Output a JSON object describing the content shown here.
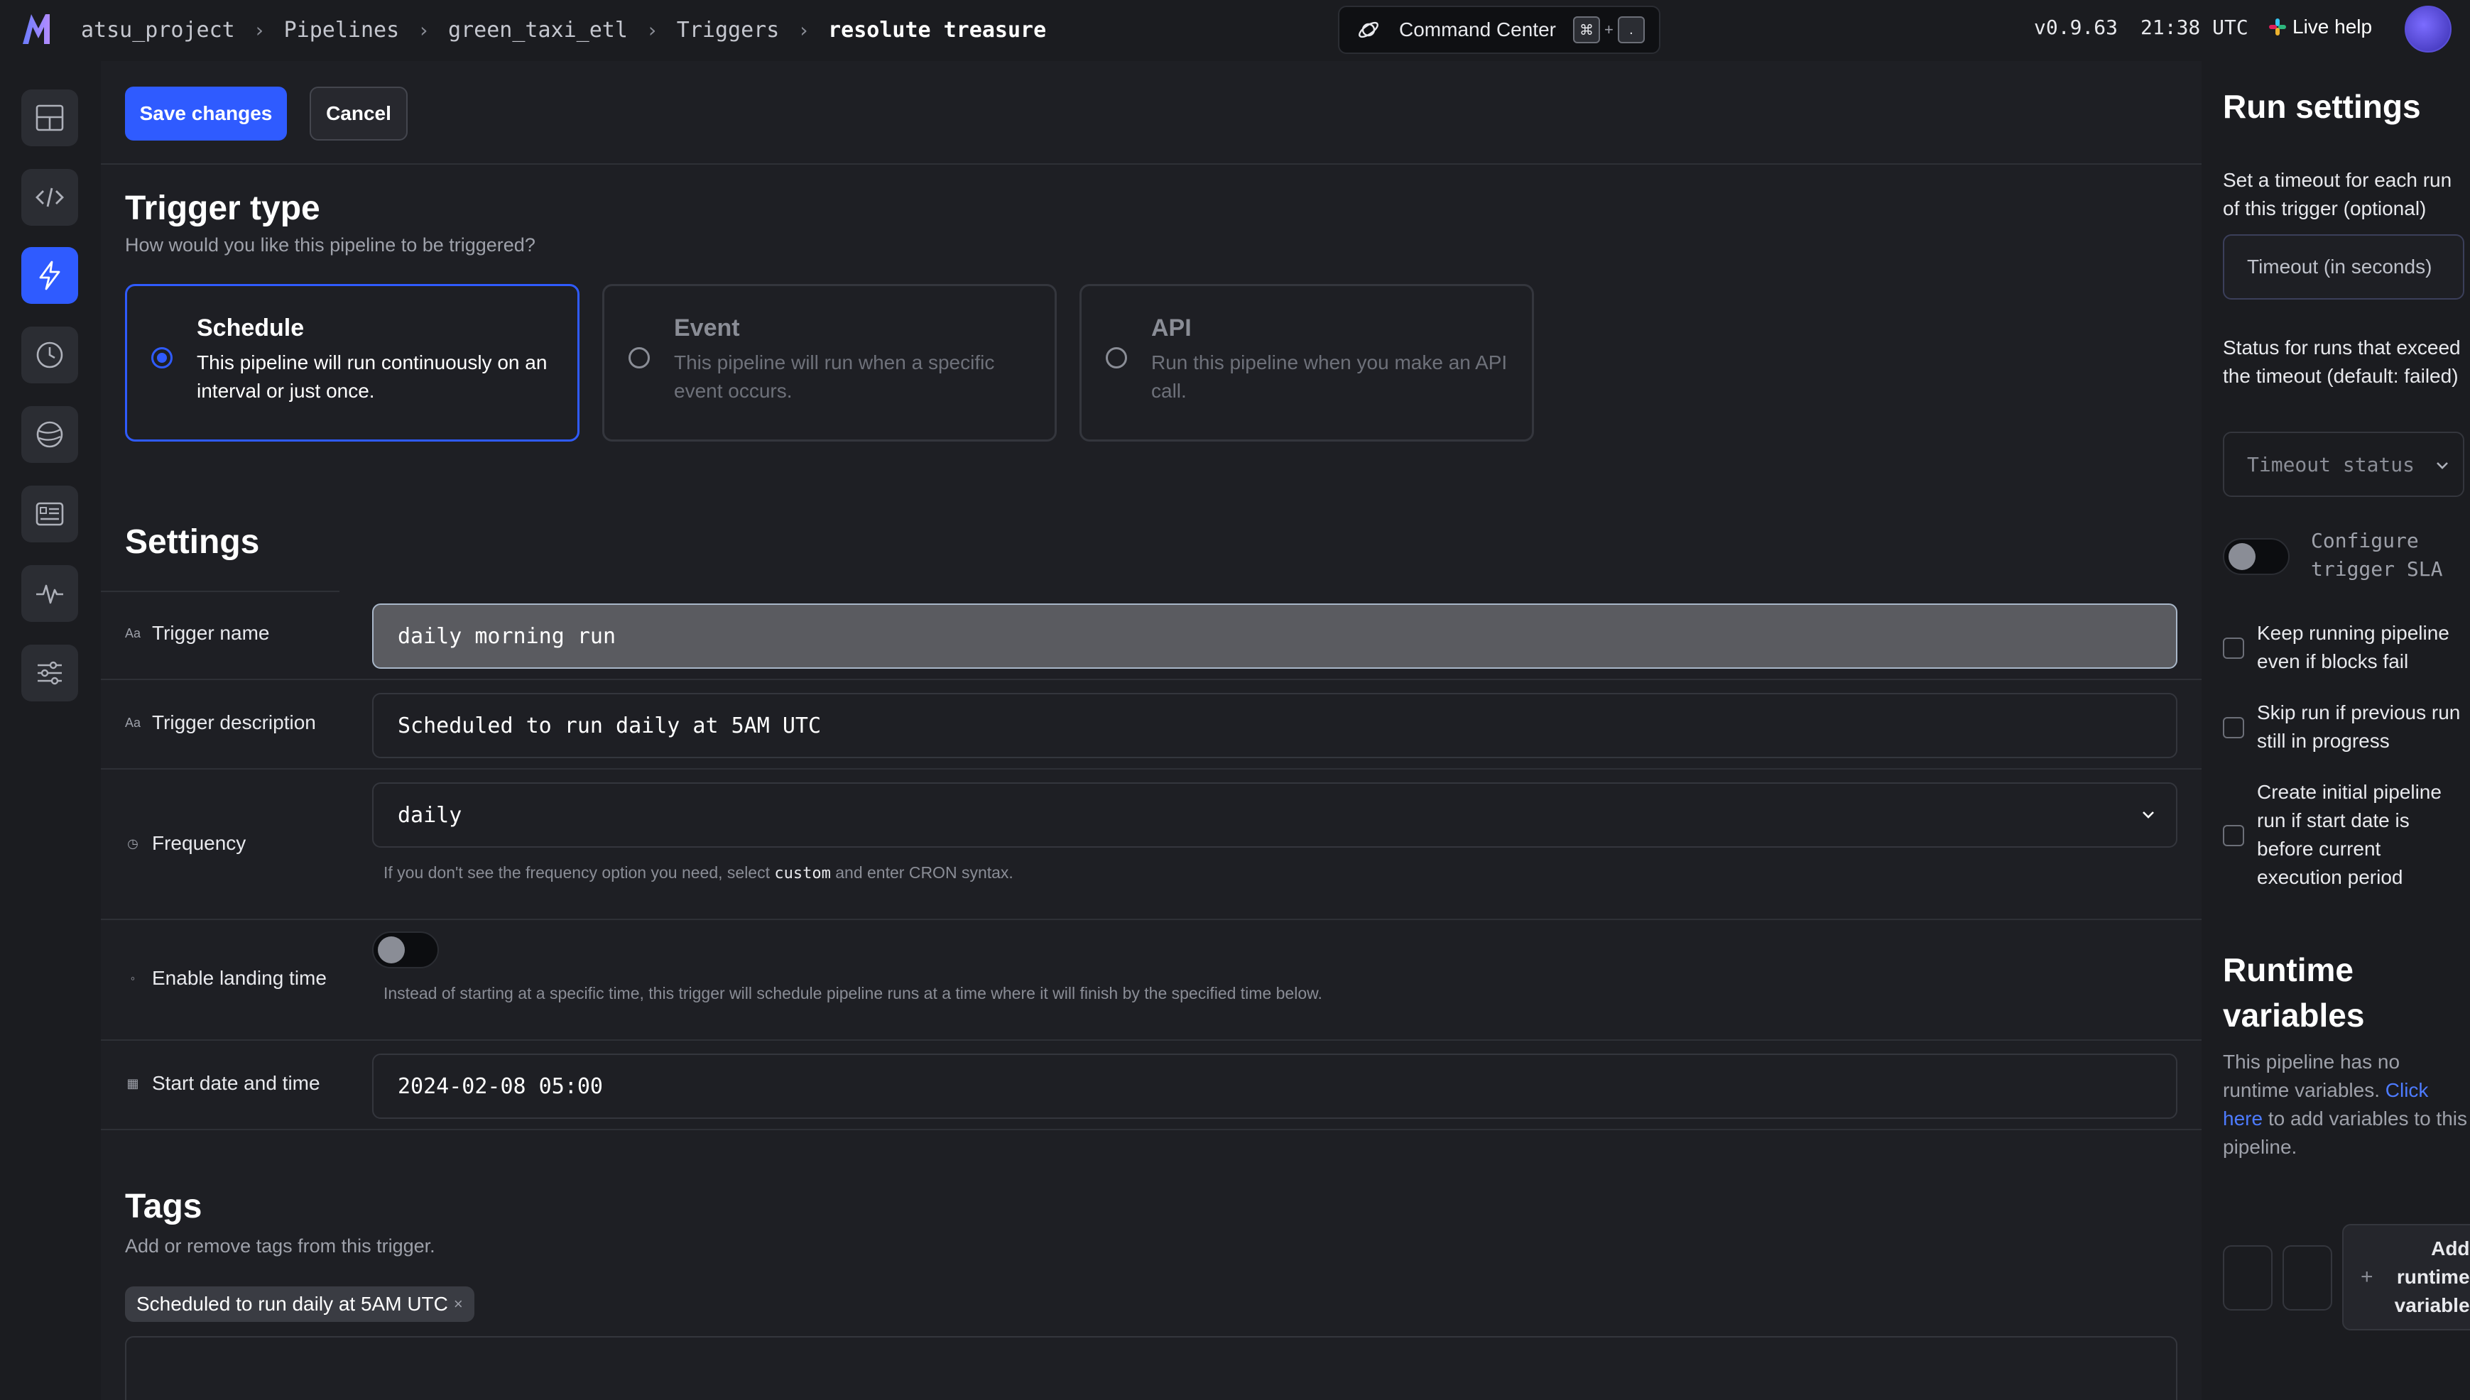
{
  "header": {
    "breadcrumbs": [
      "atsu_project",
      "Pipelines",
      "green_taxi_etl",
      "Triggers",
      "resolute treasure"
    ],
    "command_center": {
      "label": "Command Center",
      "key1": "⌘",
      "plus": "+",
      "key2": "."
    },
    "version": "v0.9.63",
    "time": "21:38 UTC",
    "live_help": "Live help"
  },
  "toolbar": {
    "save_label": "Save changes",
    "cancel_label": "Cancel"
  },
  "trigger_type": {
    "title": "Trigger type",
    "subtitle": "How would you like this pipeline to be triggered?",
    "options": [
      {
        "title": "Schedule",
        "desc": "This pipeline will run continuously on an interval or just once.",
        "selected": true
      },
      {
        "title": "Event",
        "desc": "This pipeline will run when a specific event occurs.",
        "selected": false
      },
      {
        "title": "API",
        "desc": "Run this pipeline when you make an API call.",
        "selected": false
      }
    ]
  },
  "settings": {
    "title": "Settings",
    "trigger_name": {
      "label": "Trigger name",
      "value": "daily morning run"
    },
    "trigger_description": {
      "label": "Trigger description",
      "value": "Scheduled to run daily at 5AM UTC"
    },
    "frequency": {
      "label": "Frequency",
      "value": "daily",
      "hint_pre": "If you don't see the frequency option you need, select",
      "hint_code": "custom",
      "hint_post": "and enter CRON syntax."
    },
    "landing_time": {
      "label": "Enable landing time",
      "enabled": false,
      "hint": "Instead of starting at a specific time, this trigger will schedule pipeline runs at a time where it will finish by the specified time below."
    },
    "start_date": {
      "label": "Start date and time",
      "value": "2024-02-08 05:00"
    }
  },
  "tags": {
    "title": "Tags",
    "subtitle": "Add or remove tags from this trigger.",
    "items": [
      "Scheduled to run daily at 5AM UTC"
    ],
    "remove_glyph": "×"
  },
  "run_settings": {
    "title": "Run settings",
    "timeout_desc": "Set a timeout for each run of this trigger (optional)",
    "timeout_placeholder": "Timeout (in seconds)",
    "status_desc": "Status for runs that exceed the timeout (default: failed)",
    "status_placeholder": "Timeout status",
    "sla_label": "Configure trigger SLA",
    "checkboxes": [
      "Keep running pipeline even if blocks fail",
      "Skip run if previous run still in progress",
      "Create initial pipeline run if start date is before current execution period"
    ]
  },
  "runtime_variables": {
    "title": "Runtime variables",
    "desc_pre": "This pipeline has no runtime variables.",
    "link": "Click here",
    "desc_post": "to add variables to this pipeline.",
    "add_label": "Add runtime variable",
    "add_glyph": "+"
  },
  "colors": {
    "accent": "#2f5bff",
    "background": "#1e1f24",
    "sidebar": "#1b1c20"
  }
}
